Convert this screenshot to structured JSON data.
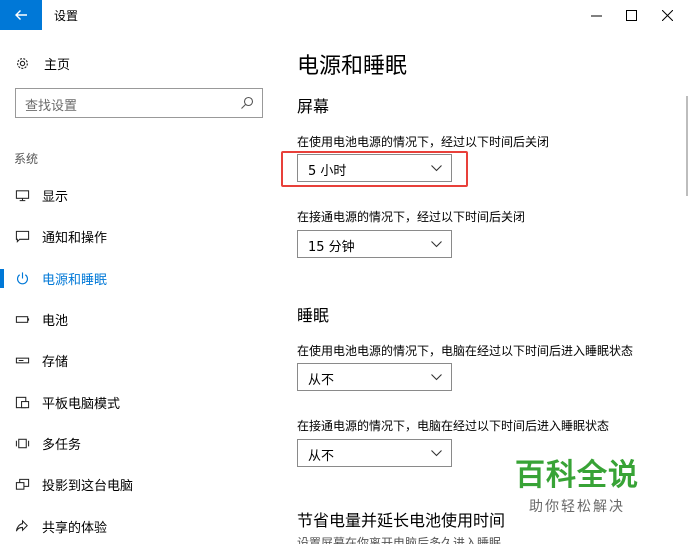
{
  "window": {
    "title": "设置",
    "back_icon": "arrow-left-icon",
    "accent": "#0078d7"
  },
  "sidebar": {
    "home_label": "主页",
    "search_placeholder": "查找设置",
    "group_label": "系统",
    "items": [
      {
        "label": "显示",
        "icon": "monitor-icon",
        "active": false
      },
      {
        "label": "通知和操作",
        "icon": "message-icon",
        "active": false
      },
      {
        "label": "电源和睡眠",
        "icon": "power-icon",
        "active": true
      },
      {
        "label": "电池",
        "icon": "battery-icon",
        "active": false
      },
      {
        "label": "存储",
        "icon": "storage-icon",
        "active": false
      },
      {
        "label": "平板电脑模式",
        "icon": "tablet-icon",
        "active": false
      },
      {
        "label": "多任务",
        "icon": "multitask-icon",
        "active": false
      },
      {
        "label": "投影到这台电脑",
        "icon": "project-icon",
        "active": false
      },
      {
        "label": "共享的体验",
        "icon": "share-icon",
        "active": false
      }
    ]
  },
  "main": {
    "title": "电源和睡眠",
    "screen": {
      "heading": "屏幕",
      "battery_label": "在使用电池电源的情况下，经过以下时间后关闭",
      "battery_value": "5 小时",
      "plugged_label": "在接通电源的情况下，经过以下时间后关闭",
      "plugged_value": "15 分钟"
    },
    "sleep": {
      "heading": "睡眠",
      "battery_label": "在使用电池电源的情况下，电脑在经过以下时间后进入睡眠状态",
      "battery_value": "从不",
      "plugged_label": "在接通电源的情况下，电脑在经过以下时间后进入睡眠状态",
      "plugged_value": "从不"
    },
    "saver": {
      "heading": "节省电量并延长电池使用时间",
      "text": "设置屏幕在你离开电脑后多久进入睡眠"
    }
  },
  "watermark": {
    "main": "百科全说",
    "sub": "助你轻松解决"
  },
  "colors": {
    "highlight": "#e8403a",
    "watermark": "#38a336"
  }
}
